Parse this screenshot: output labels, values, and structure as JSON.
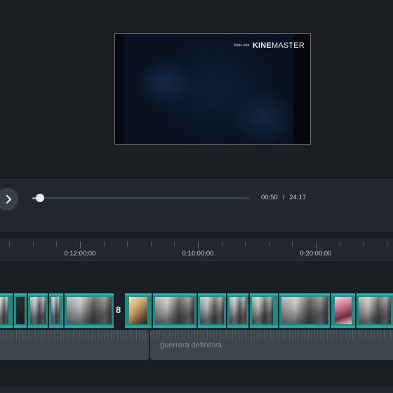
{
  "preview": {
    "watermark_small": "Made with",
    "watermark_brand_bold": "KINE",
    "watermark_brand_light": "MASTER"
  },
  "player": {
    "play_icon": "chevron-right-icon",
    "current_time": "00:50",
    "separator": "/",
    "total_time": "24:17",
    "progress_fraction": 0.034
  },
  "ruler": {
    "labels": [
      "0:12:00;00",
      "0:16:00;00",
      "0:20:00;00"
    ]
  },
  "timeline": {
    "clip_number": "8",
    "audio_clip_title": "guerrera definitiva"
  },
  "colors": {
    "accent_teal": "#2bb3ae",
    "background": "#1b1f24",
    "panel": "#22272d"
  }
}
